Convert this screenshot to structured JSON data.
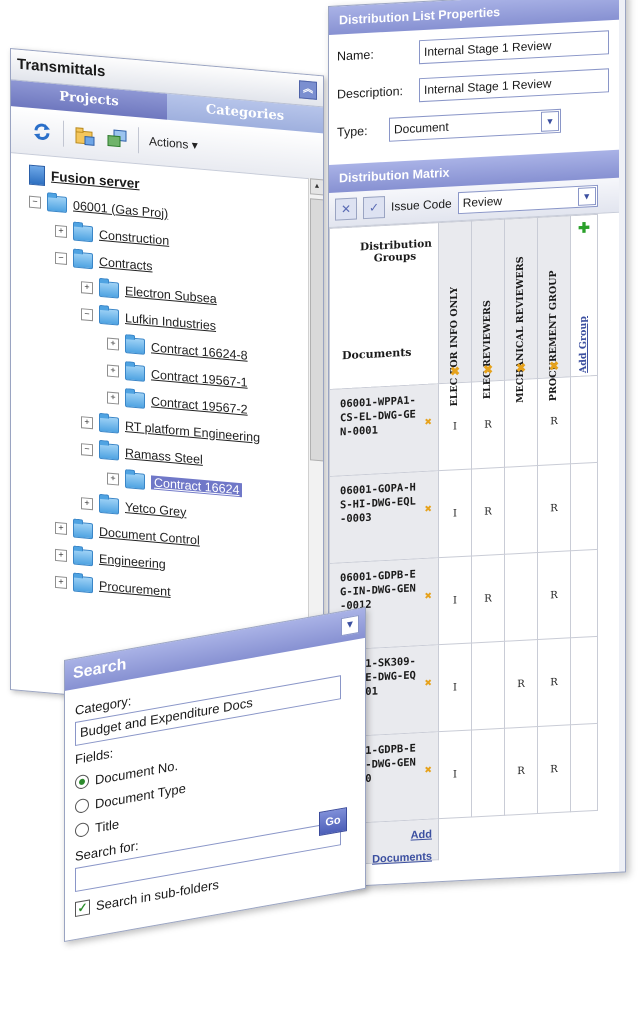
{
  "transmittals": {
    "title": "Transmittals",
    "collapse_icon": "double-chevron-up",
    "tabs": [
      {
        "label": "Projects",
        "active": true
      },
      {
        "label": "Categories",
        "active": false
      }
    ],
    "toolbar": {
      "actions_label": "Actions",
      "icons": [
        "refresh-icon",
        "new-folder-icon",
        "copy-folder-icon"
      ]
    },
    "tree": {
      "server": "Fusion server",
      "nodes": [
        {
          "label": "06001 (Gas Proj)",
          "expander": "−",
          "level": 1
        },
        {
          "label": "Construction",
          "expander": "+",
          "level": 2
        },
        {
          "label": "Contracts",
          "expander": "−",
          "level": 2
        },
        {
          "label": "Electron Subsea",
          "expander": "+",
          "level": 3
        },
        {
          "label": "Lufkin Industries",
          "expander": "−",
          "level": 3
        },
        {
          "label": "Contract 16624-8",
          "expander": "+",
          "level": 4
        },
        {
          "label": "Contract 19567-1",
          "expander": "+",
          "level": 4
        },
        {
          "label": "Contract 19567-2",
          "expander": "+",
          "level": 4
        },
        {
          "label": "RT platform Engineering",
          "expander": "+",
          "level": 3
        },
        {
          "label": "Ramass Steel",
          "expander": "−",
          "level": 3
        },
        {
          "label": "Contract 16624",
          "expander": "+",
          "level": 4,
          "selected": true
        },
        {
          "label": "Yetco Grey",
          "expander": "+",
          "level": 3
        },
        {
          "label": "Document Control",
          "expander": "+",
          "level": 2
        },
        {
          "label": "Engineering",
          "expander": "+",
          "level": 2
        },
        {
          "label": "Procurement",
          "expander": "+",
          "level": 2
        }
      ]
    }
  },
  "search": {
    "title": "Search",
    "category_label": "Category:",
    "category_value": "Budget and Expenditure Docs",
    "fields_label": "Fields:",
    "fields": [
      {
        "label": "Document No.",
        "checked": true
      },
      {
        "label": "Document Type",
        "checked": false
      },
      {
        "label": "Title",
        "checked": false
      }
    ],
    "go_label": "Go",
    "search_for_label": "Search for:",
    "search_for_value": "",
    "subfolders_label": "Search in sub-folders",
    "subfolders_checked": true
  },
  "distribution_list": {
    "title": "Distribution List Properties",
    "name_label": "Name:",
    "name_value": "Internal Stage 1 Review",
    "description_label": "Description:",
    "description_value": "Internal Stage 1 Review",
    "type_label": "Type:",
    "type_value": "Document"
  },
  "matrix": {
    "title": "Distribution Matrix",
    "issue_code_label": "Issue Code",
    "issue_code_value": "Review",
    "groups_header": "Distribution Groups",
    "documents_header": "Documents",
    "groups": [
      "ELEC FOR INFO ONLY",
      "ELEC REVIEWERS",
      "MECHANICAL REVIEWERS",
      "PROCUREMENT GROUP"
    ],
    "add_group_label": "Add Group",
    "documents": [
      {
        "number": "06001-WPPA1-CS-EL-DWG-GEN-0001",
        "codes": [
          "I",
          "R",
          "",
          "R"
        ]
      },
      {
        "number": "06001-GOPA-HS-HI-DWG-EQL-0003",
        "codes": [
          "I",
          "R",
          "",
          "R"
        ]
      },
      {
        "number": "06001-GDPB-EG-IN-DWG-GEN-0012",
        "codes": [
          "I",
          "R",
          "",
          "R"
        ]
      },
      {
        "number": "06001-SK309-EG-ME-DWG-EQL-0001",
        "codes": [
          "I",
          "",
          "R",
          "R"
        ]
      },
      {
        "number": "06001-GDPB-EG-IN-DWG-GEN-0010",
        "codes": [
          "I",
          "",
          "R",
          "R"
        ]
      }
    ],
    "add_documents_label": "Add Documents",
    "colors": {
      "remove_mark": "#e6a21c",
      "add_mark": "#2aa02a",
      "header": "#8791d2"
    }
  }
}
